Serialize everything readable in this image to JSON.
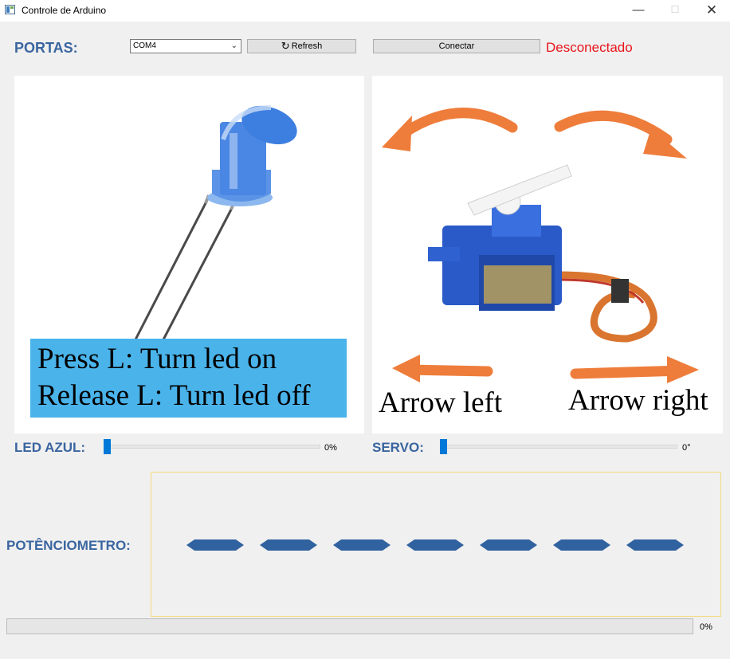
{
  "window": {
    "title": "Controle de Arduino",
    "minimize_glyph": "—",
    "maximize_glyph": "☐",
    "close_glyph": "✕"
  },
  "ports": {
    "label": "PORTAS:",
    "selected_port": "COM4",
    "refresh_label": "Refresh",
    "connect_label": "Conectar",
    "status": "Desconectado",
    "status_color": "#e8151b"
  },
  "led_panel": {
    "caption_line1": "Press L: Turn led on",
    "caption_line2": "Release L: Turn led off",
    "caption_bg": "#4ab3ea",
    "led_color": "#3d7fe0"
  },
  "servo_panel": {
    "arrow_left_label": "Arrow left",
    "arrow_right_label": "Arrow right",
    "arrow_color": "#ee7d3b"
  },
  "led_slider": {
    "label": "LED AZUL:",
    "value_text": "0%",
    "value": 0
  },
  "servo_slider": {
    "label": "SERVO:",
    "value_text": "0°",
    "value": 0
  },
  "potentiometer": {
    "label": "POTÊNCIOMETRO:",
    "segment_count": 7,
    "segment_color": "#3162a0"
  },
  "progress": {
    "value_text": "0%",
    "value": 0
  },
  "accent_color": "#0078d7",
  "label_color": "#3a65a0"
}
